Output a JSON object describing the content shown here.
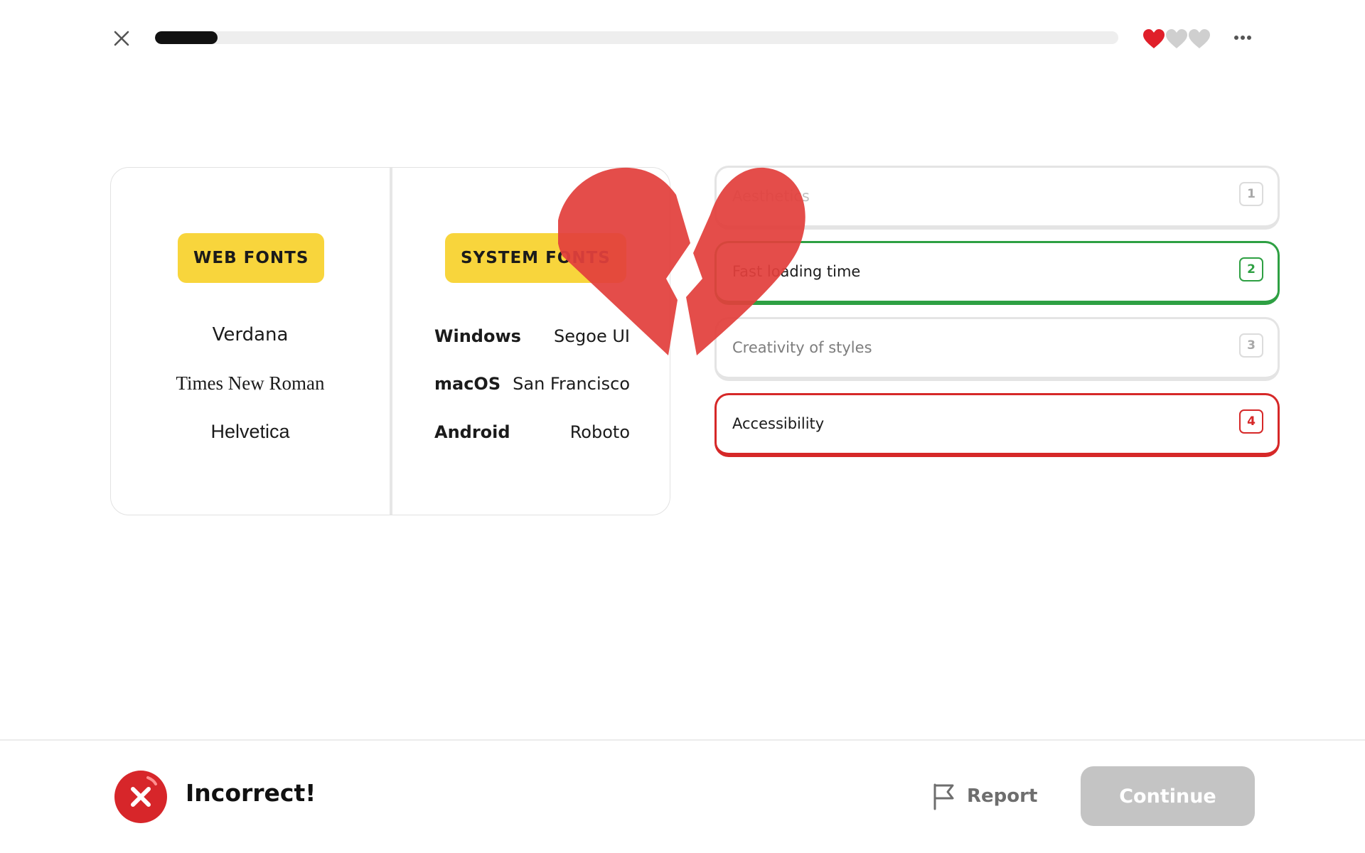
{
  "header": {
    "progress_percent": 6.5,
    "lives_total": 3,
    "lives_remaining": 1,
    "colors": {
      "heart_full": "#e01f2a",
      "heart_empty": "#cfcfcf"
    }
  },
  "card": {
    "web_fonts": {
      "tag": "WEB FONTS",
      "items": [
        "Verdana",
        "Times New Roman",
        "Helvetica"
      ]
    },
    "system_fonts": {
      "tag": "SYSTEM FONTS",
      "rows": [
        {
          "os": "Windows",
          "font": "Segoe UI"
        },
        {
          "os": "macOS",
          "font": "San Francisco"
        },
        {
          "os": "Android",
          "font": "Roboto"
        }
      ]
    },
    "tag_color": "#f8d53c"
  },
  "options": [
    {
      "label": "Aesthetics",
      "key": "1",
      "state": "default"
    },
    {
      "label": "Fast loading time",
      "key": "2",
      "state": "correct"
    },
    {
      "label": "Creativity of styles",
      "key": "3",
      "state": "default"
    },
    {
      "label": "Accessibility",
      "key": "4",
      "state": "incorrect"
    }
  ],
  "overlay": {
    "icon": "broken-heart-icon",
    "color": "#e2403c"
  },
  "footer": {
    "result": "Incorrect!",
    "result_icon": "x-circle-icon",
    "report_label": "Report",
    "continue_label": "Continue",
    "colors": {
      "error": "#d7262a",
      "correct": "#2ea043",
      "button_disabled": "#c4c4c4"
    }
  }
}
